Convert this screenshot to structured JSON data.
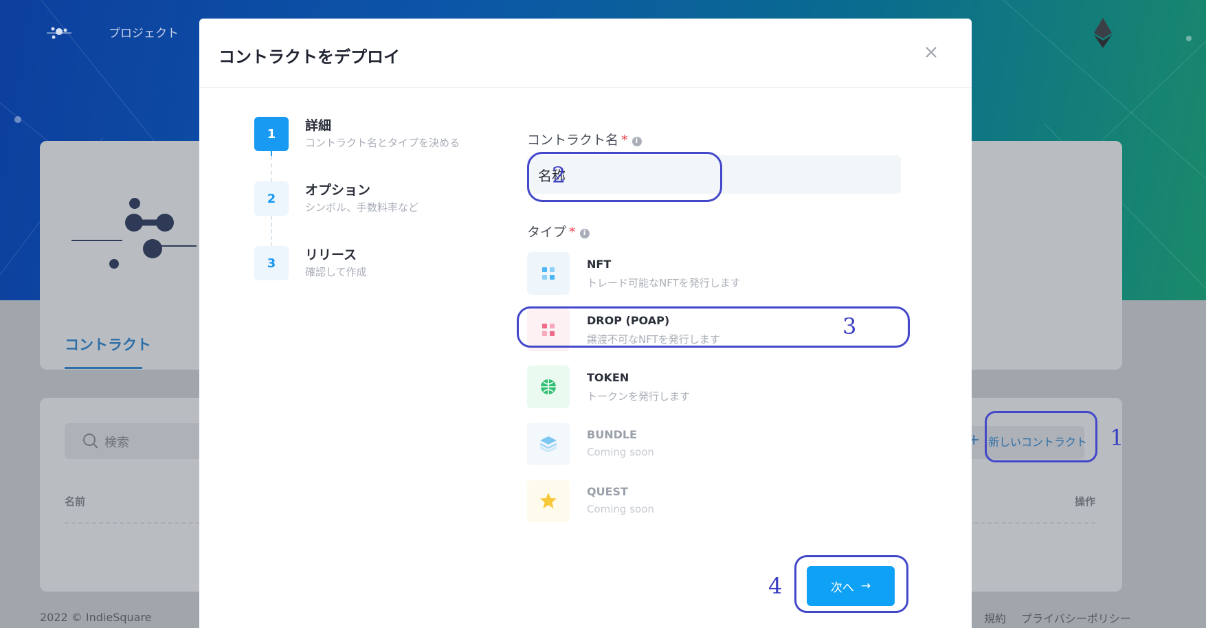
{
  "background": {
    "nav_link": "プロジェクト",
    "tab": "コントラクト",
    "search_placeholder": "検索",
    "new_contract_plus": "+",
    "new_contract": "新しいコントラクト",
    "table_headers": {
      "name": "名前",
      "actions": "操作"
    },
    "footer_left": "2022 © IndieSquare",
    "footer_links": [
      "規約",
      "プライバシーポリシー"
    ]
  },
  "modal": {
    "title": "コントラクトをデプロイ",
    "close_symbol": "×",
    "steps": [
      {
        "number": "1",
        "title": "詳細",
        "desc": "コントラクト名とタイプを決める",
        "active": true
      },
      {
        "number": "2",
        "title": "オプション",
        "desc": "シンボル、手数料率など",
        "active": false
      },
      {
        "number": "3",
        "title": "リリース",
        "desc": "確認して作成",
        "active": false
      }
    ],
    "name_field": {
      "label": "コントラクト名",
      "required_mark": "*",
      "info": "i",
      "value": "名称"
    },
    "type_field": {
      "label": "タイプ",
      "required_mark": "*",
      "info": "i"
    },
    "types": [
      {
        "name": "NFT",
        "desc": "トレード可能なNFTを発行します",
        "icon": "nft-grid-icon",
        "icon_color": "#4cb5f5",
        "bg": "#eef6fc",
        "selected": false,
        "disabled": false
      },
      {
        "name": "DROP (POAP)",
        "desc": "譲渡不可なNFTを発行します",
        "icon": "drop-grid-icon",
        "icon_color": "#f06a8a",
        "bg": "#fdf1f4",
        "selected": true,
        "disabled": false
      },
      {
        "name": "TOKEN",
        "desc": "トークンを発行します",
        "icon": "token-globe-icon",
        "icon_color": "#2fbf71",
        "bg": "#eafaf1",
        "selected": false,
        "disabled": false
      },
      {
        "name": "BUNDLE",
        "desc": "Coming soon",
        "icon": "bundle-layers-icon",
        "icon_color": "#7cc6f2",
        "bg": "#f3f8fc",
        "selected": false,
        "disabled": true
      },
      {
        "name": "QUEST",
        "desc": "Coming soon",
        "icon": "quest-star-icon",
        "icon_color": "#f7c83a",
        "bg": "#fffbec",
        "selected": false,
        "disabled": true
      }
    ],
    "next_button": "次へ",
    "next_arrow": "→"
  },
  "annotations": [
    "1",
    "2",
    "3",
    "4"
  ],
  "colors": {
    "primary": "#1899f2",
    "annotation": "#4347c9",
    "required": "#e8404e"
  }
}
